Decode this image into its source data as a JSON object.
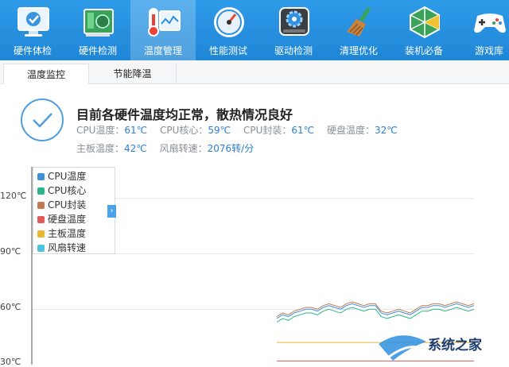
{
  "toolbar": {
    "items": [
      {
        "label": "硬件体检",
        "icon": "monitor-checkmark-icon"
      },
      {
        "label": "硬件检测",
        "icon": "circuit-board-icon"
      },
      {
        "label": "温度管理",
        "icon": "thermometer-icon",
        "active": true
      },
      {
        "label": "性能测试",
        "icon": "speedometer-icon"
      },
      {
        "label": "驱动检测",
        "icon": "gear-disk-icon"
      },
      {
        "label": "清理优化",
        "icon": "broom-icon"
      },
      {
        "label": "装机必备",
        "icon": "app-cube-icon"
      },
      {
        "label": "游戏库",
        "icon": "gamepad-icon"
      }
    ]
  },
  "tabs": [
    {
      "label": "温度监控",
      "active": true
    },
    {
      "label": "节能降温",
      "active": false
    }
  ],
  "status": {
    "title": "目前各硬件温度均正常，散热情况良好",
    "row1": [
      {
        "key": "CPU温度：",
        "value": "61℃"
      },
      {
        "key": "CPU核心：",
        "value": "59℃"
      },
      {
        "key": "CPU封装：",
        "value": "61℃"
      },
      {
        "key": "硬盘温度：",
        "value": "32℃"
      }
    ],
    "row2": [
      {
        "key": "主板温度：",
        "value": "42℃"
      },
      {
        "key": "风扇转速：",
        "value": "2076转/分"
      }
    ]
  },
  "chart_data": {
    "type": "line",
    "y_ticks": [
      "120℃",
      "90℃",
      "60℃",
      "30℃"
    ],
    "ylim": [
      30,
      120
    ],
    "grid": true,
    "legend_position": "top-left",
    "series": [
      {
        "name": "CPU温度",
        "color": "#3f8fd8",
        "values": [
          55,
          57,
          56,
          58,
          59,
          60,
          60,
          59,
          61,
          62,
          61,
          60,
          62,
          63,
          62,
          61,
          62,
          62,
          58,
          57,
          58,
          59,
          58,
          57,
          59,
          61,
          61,
          62,
          62,
          61,
          62,
          63,
          62,
          61,
          62
        ]
      },
      {
        "name": "CPU核心",
        "color": "#2db58a",
        "values": [
          53,
          55,
          54,
          56,
          57,
          58,
          58,
          57,
          59,
          60,
          59,
          58,
          60,
          61,
          60,
          59,
          60,
          60,
          56,
          55,
          56,
          57,
          56,
          55,
          57,
          59,
          59,
          60,
          60,
          59,
          60,
          61,
          60,
          59,
          60
        ]
      },
      {
        "name": "CPU封装",
        "color": "#c07a52",
        "values": [
          56,
          58,
          57,
          59,
          60,
          61,
          61,
          60,
          62,
          63,
          62,
          61,
          63,
          64,
          63,
          62,
          63,
          63,
          59,
          58,
          59,
          60,
          59,
          58,
          60,
          62,
          62,
          63,
          63,
          62,
          63,
          64,
          63,
          62,
          63
        ]
      },
      {
        "name": "硬盘温度",
        "color": "#e05a5a",
        "values": [
          32,
          32,
          32,
          32,
          32,
          32,
          32,
          32,
          32,
          32,
          32,
          32,
          32,
          32,
          32,
          32,
          32,
          32,
          32,
          32,
          32,
          32,
          32,
          32,
          32,
          32,
          32,
          32,
          32,
          32,
          32,
          32,
          32,
          32,
          32
        ]
      },
      {
        "name": "主板温度",
        "color": "#e8b830",
        "values": [
          42,
          42,
          42,
          42,
          42,
          42,
          42,
          42,
          42,
          42,
          42,
          42,
          42,
          42,
          42,
          42,
          42,
          42,
          42,
          42,
          42,
          42,
          42,
          42,
          42,
          42,
          42,
          42,
          42,
          42,
          42,
          42,
          42,
          42,
          42
        ]
      },
      {
        "name": "风扇转速",
        "color": "#4ec3e0",
        "values": []
      }
    ]
  },
  "watermark": {
    "text": "系统之家"
  }
}
